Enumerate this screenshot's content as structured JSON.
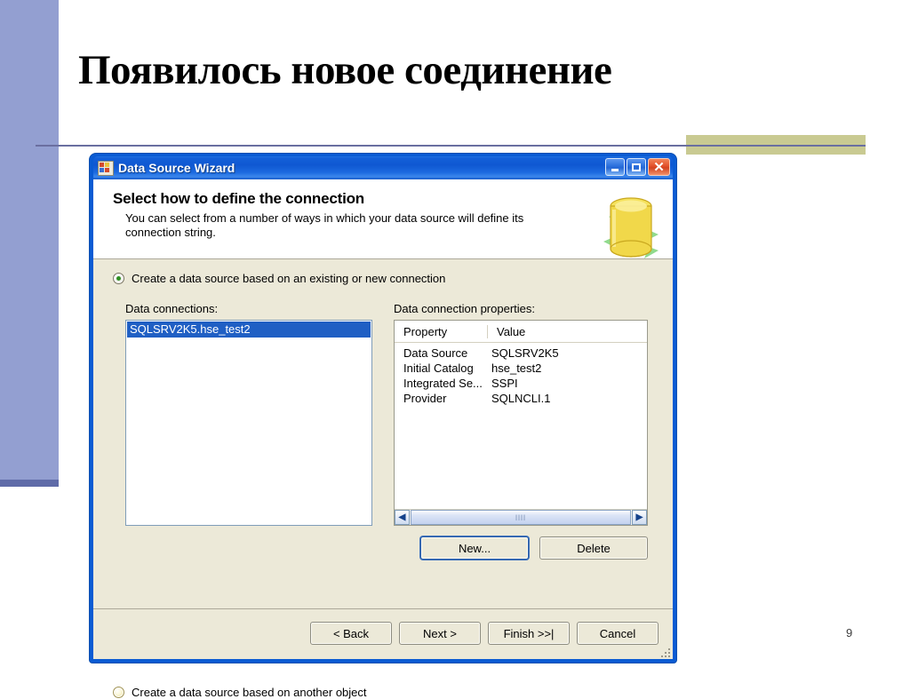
{
  "slide": {
    "title": "Появилось новое соединение",
    "page_number": "9",
    "accent_left_color": "#939fd1",
    "accent_block_color": "#c9ca92",
    "rule_color": "#6a6fa0"
  },
  "dialog": {
    "title": "Data Source Wizard",
    "icon": "data-source-wizard-icon",
    "window_buttons": {
      "minimize": "minimize-icon",
      "maximize": "maximize-icon",
      "close": "close-icon",
      "close_glyph": "✕"
    },
    "header": {
      "title": "Select how to define the connection",
      "subtitle": "You can select from a number of ways in which your data source will define its connection string.",
      "illustration": "database-cylinder-icon"
    },
    "options": [
      {
        "id": "existing-or-new-connection",
        "label_before": "C",
        "label_accel": "r",
        "label_after": "eate a data source based on an existing or new connection",
        "full_label": "Create a data source based on an existing or new connection",
        "selected": true
      },
      {
        "id": "another-object",
        "full_label": "Create a data source based on another object",
        "selected": false
      }
    ],
    "connections": {
      "label": "Data connections:",
      "items": [
        {
          "name": "SQLSRV2K5.hse_test2",
          "selected": true
        }
      ]
    },
    "properties": {
      "label": "Data connection properties:",
      "columns": [
        "Property",
        "Value"
      ],
      "rows": [
        {
          "property": "Data Source",
          "value": "SQLSRV2K5"
        },
        {
          "property": "Initial Catalog",
          "value": "hse_test2"
        },
        {
          "property": "Integrated Se...",
          "value": "SSPI"
        },
        {
          "property": "Provider",
          "value": "SQLNCLI.1"
        }
      ],
      "scrollbar": {
        "left_arrow": "◀",
        "right_arrow": "▶",
        "grip": "llll"
      }
    },
    "actions": {
      "new_label": "New...",
      "delete_label": "Delete"
    },
    "wizard_buttons": [
      {
        "id": "back",
        "label": "< Back"
      },
      {
        "id": "next",
        "label": "Next >"
      },
      {
        "id": "finish",
        "label": "Finish >>|"
      },
      {
        "id": "cancel",
        "label": "Cancel"
      }
    ],
    "colors": {
      "titlebar": "#0f58d2",
      "client_background": "#ece9d8",
      "selection": "#1f5fc4",
      "radio_selected_dot": "#2f8f22"
    }
  }
}
